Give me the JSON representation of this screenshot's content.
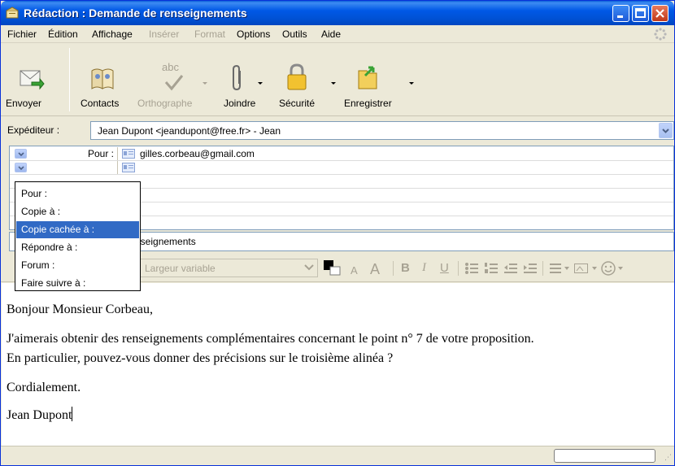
{
  "window": {
    "title": "Rédaction : Demande de renseignements"
  },
  "menu": {
    "items": [
      {
        "label": "Fichier",
        "disabled": false
      },
      {
        "label": "Édition",
        "disabled": false
      },
      {
        "label": "Affichage",
        "disabled": false
      },
      {
        "label": "Insérer",
        "disabled": true
      },
      {
        "label": "Format",
        "disabled": true
      },
      {
        "label": "Options",
        "disabled": false
      },
      {
        "label": "Outils",
        "disabled": false
      },
      {
        "label": "Aide",
        "disabled": false
      }
    ]
  },
  "toolbar": {
    "send": "Envoyer",
    "contacts": "Contacts",
    "spelling": "Orthographe",
    "spelling_icon_text": "abc",
    "attach": "Joindre",
    "security": "Sécurité",
    "save": "Enregistrer"
  },
  "sender": {
    "label": "Expéditeur :",
    "value": "Jean Dupont <jeandupont@free.fr>   - Jean"
  },
  "recipients": {
    "rows": [
      {
        "type": "Pour :",
        "address": "gilles.corbeau@gmail.com"
      },
      {
        "type": "",
        "address": ""
      }
    ]
  },
  "recipient_type_options": {
    "items": [
      "Pour :",
      "Copie à :",
      "Copie cachée à :",
      "Répondre à :",
      "Forum :",
      "Faire suivre à :"
    ],
    "selected": "Copie cachée à :"
  },
  "subject": {
    "visible_text": "nseignements"
  },
  "format": {
    "font": "Largeur variable",
    "bold": "B",
    "italic": "I",
    "underline": "U",
    "font_smaller": "A",
    "font_larger": "A"
  },
  "body": {
    "lines": [
      "Bonjour Monsieur Corbeau,",
      "J'aimerais obtenir des renseignements complémentaires concernant le point n° 7 de votre proposition.",
      "En particulier, pouvez-vous donner des précisions sur le troisième alinéa ?",
      "Cordialement.",
      "Jean Dupont"
    ]
  },
  "colors": {
    "titlebar": "#0058e6",
    "selection": "#316ac5",
    "chrome": "#ece9d8"
  },
  "icons": [
    "envelope-send-icon",
    "contacts-book-icon",
    "spelling-check-icon",
    "paperclip-icon",
    "padlock-icon",
    "folder-save-icon"
  ]
}
